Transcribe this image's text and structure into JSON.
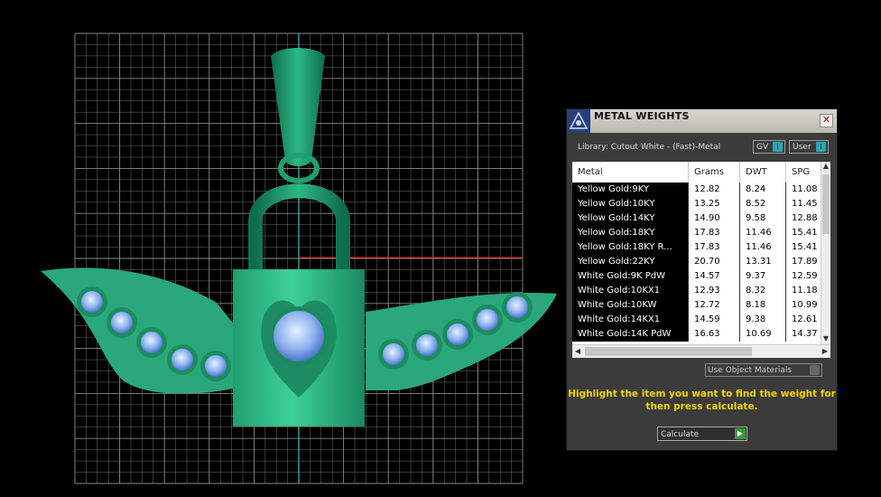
{
  "viewport": {
    "bg": "#000000",
    "grid_color": "#8a8a8a",
    "object_color": "#22a574",
    "gem_color": "#8fb3f0",
    "axis_colors": {
      "vertical": "#3fb9cf",
      "horizontal": "#d21e1e"
    }
  },
  "panel": {
    "title": "METAL WEIGHTS",
    "close_icon": "close-icon",
    "library": "Library: Cutout White - (Fast)-Metal",
    "toggle_gv": "GV",
    "toggle_user": "User",
    "columns": [
      "Metal",
      "Grams",
      "DWT",
      "SPG"
    ],
    "rows": [
      [
        "Yellow Gold:9KY",
        "12.82",
        "8.24",
        "11.08"
      ],
      [
        "Yellow Gold:10KY",
        "13.25",
        "8.52",
        "11.45"
      ],
      [
        "Yellow Gold:14KY",
        "14.90",
        "9.58",
        "12.88"
      ],
      [
        "Yellow Gold:18KY",
        "17.83",
        "11.46",
        "15.41"
      ],
      [
        "Yellow Gold:18KY R...",
        "17.83",
        "11.46",
        "15.41"
      ],
      [
        "Yellow Gold:22KY",
        "20.70",
        "13.31",
        "17.89"
      ],
      [
        "White Gold:9K PdW",
        "14.57",
        "9.37",
        "12.59"
      ],
      [
        "White Gold:10KX1",
        "12.93",
        "8.32",
        "11.18"
      ],
      [
        "White Gold:10KW",
        "12.72",
        "8.18",
        "10.99"
      ],
      [
        "White Gold:14KX1",
        "14.59",
        "9.38",
        "12.61"
      ],
      [
        "White Gold:14K PdW",
        "16.63",
        "10.69",
        "14.37"
      ]
    ],
    "use_object_materials": "Use Object Materials",
    "hint": "Highlight the item you want to find the weight for then press calculate.",
    "calculate": "Calculate"
  }
}
